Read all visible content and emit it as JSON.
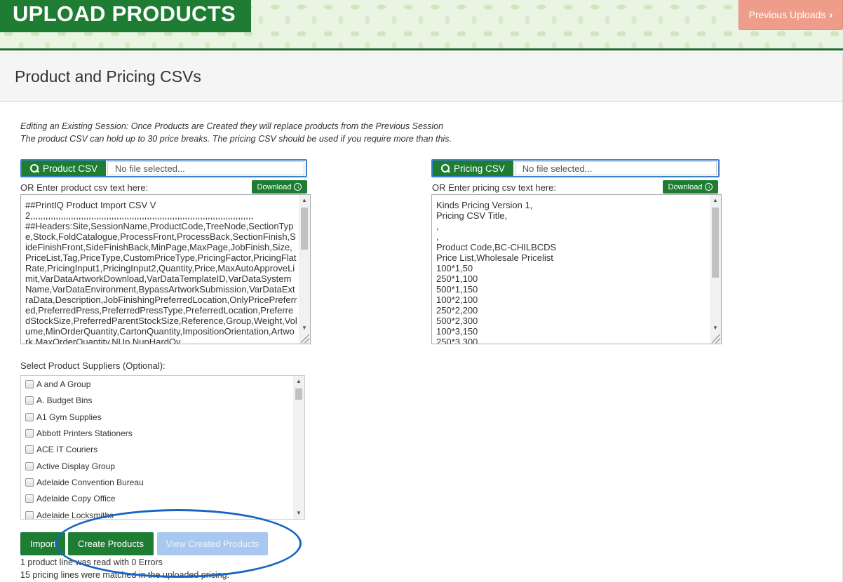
{
  "header": {
    "title": "UPLOAD PRODUCTS",
    "previous_uploads": "Previous Uploads",
    "chevron": "›"
  },
  "panel": {
    "title": "Product and Pricing CSVs",
    "note_line1": "Editing an Existing Session: Once Products are Created they will replace products from the Previous Session",
    "note_line2": "The product CSV can hold up to 30 price breaks. The pricing CSV should be used if you require more than this."
  },
  "product_csv": {
    "button_label": "Product CSV",
    "file_placeholder": "No file selected...",
    "text_label": "OR Enter product csv text here:",
    "download_label": "Download",
    "text": "##PrintIQ Product Import CSV V2,,,,,,,,,,,,,,,,,,,,,,,,,,,,,,,,,,,,,,,,,,,,,,,,,,,,,,,,,,,,,,,,,,,,,,,,,,,,,,,,,,,,,,,,\n##Headers:Site,SessionName,ProductCode,TreeNode,SectionType,Stock,FoldCatalogue,ProcessFront,ProcessBack,SectionFinish,SideFinishFront,SideFinishBack,MinPage,MaxPage,JobFinish,Size,PriceList,Tag,PriceType,CustomPriceType,PricingFactor,PricingFlatRate,PricingInput1,PricingInput2,Quantity,Price,MaxAutoApproveLimit,VarDataArtworkDownload,VarDataTemplateID,VarDataSystemName,VarDataEnvironment,BypassArtworkSubmission,VarDataExtraData,Description,JobFinishingPreferredLocation,OnlyPricePreferred,PreferredPress,PreferredPressType,PreferredLocation,PreferredStockSize,PreferredParentStockSize,Reference,Group,Weight,Volume,MinOrderQuantity,CartonQuantity,ImpositionOrientation,Artwork,MaxOrderQuantity,NUp,NupHardOv"
  },
  "pricing_csv": {
    "button_label": "Pricing CSV",
    "file_placeholder": "No file selected...",
    "text_label": "OR Enter pricing csv text here:",
    "download_label": "Download",
    "text": "Kinds Pricing Version 1,\nPricing CSV Title,\n,\n,\nProduct Code,BC-CHILBCDS\nPrice List,Wholesale Pricelist\n100*1,50\n250*1,100\n500*1,150\n100*2,100\n250*2,200\n500*2,300\n100*3,150\n250*3,300"
  },
  "suppliers": {
    "label": "Select Product Suppliers (Optional):",
    "items": [
      "A and A Group",
      "A. Budget Bins",
      "A1 Gym Supplies",
      "Abbott Printers Stationers",
      "ACE IT Couriers",
      "Active Display Group",
      "Adelaide Convention Bureau",
      "Adelaide Copy Office",
      "Adelaide Locksmiths"
    ]
  },
  "actions": {
    "import": "Import",
    "create_products": "Create Products",
    "view_created_products": "View Created Products"
  },
  "status": {
    "line1": "1 product line was read with 0 Errors",
    "line2": "15 pricing lines were matched in the uploaded pricing."
  },
  "colors": {
    "brand_green": "#1e7d32",
    "previous_uploads_bg": "#ee9d8a",
    "view_disabled_bg": "#a9c8ef",
    "annotation_blue": "#1565c0"
  }
}
